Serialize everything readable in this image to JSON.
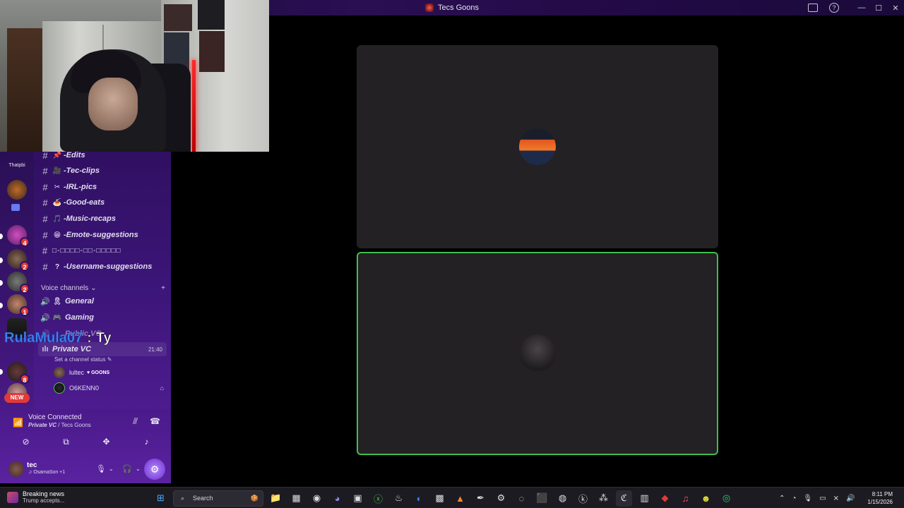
{
  "window": {
    "title": "Tecs Goons"
  },
  "rail": {
    "top_label": "Thatpbi",
    "badges": [
      "4",
      "2",
      "2",
      "1",
      "8"
    ],
    "new_label": "NEW"
  },
  "channels": [
    {
      "emoji": "📌",
      "name": "-Edits"
    },
    {
      "emoji": "🎥",
      "name": "-Tec-clips"
    },
    {
      "emoji": "✂",
      "name": "-IRL-pics"
    },
    {
      "emoji": "🍝",
      "name": "-Good-eats"
    },
    {
      "emoji": "🎵",
      "name": "-Music-recaps"
    },
    {
      "emoji": "😁",
      "name": "-Emote-suggestions"
    },
    {
      "emoji": "",
      "name": "□-□□□□-□□-□□□□□"
    },
    {
      "emoji": "?",
      "name": "-Username-suggestions"
    }
  ],
  "voice_section": {
    "label": "Voice channels",
    "add": "+"
  },
  "voice_channels": [
    {
      "emoji": "🎗",
      "name": "General"
    },
    {
      "emoji": "🎮",
      "name": "Gaming"
    },
    {
      "emoji": "",
      "name": "Public VC"
    }
  ],
  "active_vc": {
    "name": "Private VC",
    "time": "21:40",
    "status_prompt": "Set a channel status ✎"
  },
  "members": [
    {
      "name": "lultec",
      "tag": "♥ GOONS"
    },
    {
      "name": "O6KENN0",
      "tag": ""
    }
  ],
  "chat_overlay": {
    "name": "RulaMula07",
    "sep": ":",
    "message": "Ty"
  },
  "voice_panel": {
    "title": "Voice Connected",
    "channel": "Private VC",
    "server": "/ Tecs Goons"
  },
  "user": {
    "name": "tec",
    "status": "♫ OsamaSon +1"
  },
  "taskbar": {
    "news_title": "Breaking news",
    "news_sub": "Trump accepts...",
    "search_label": "Search",
    "time": "8:11 PM",
    "date": "1/15/2026"
  }
}
